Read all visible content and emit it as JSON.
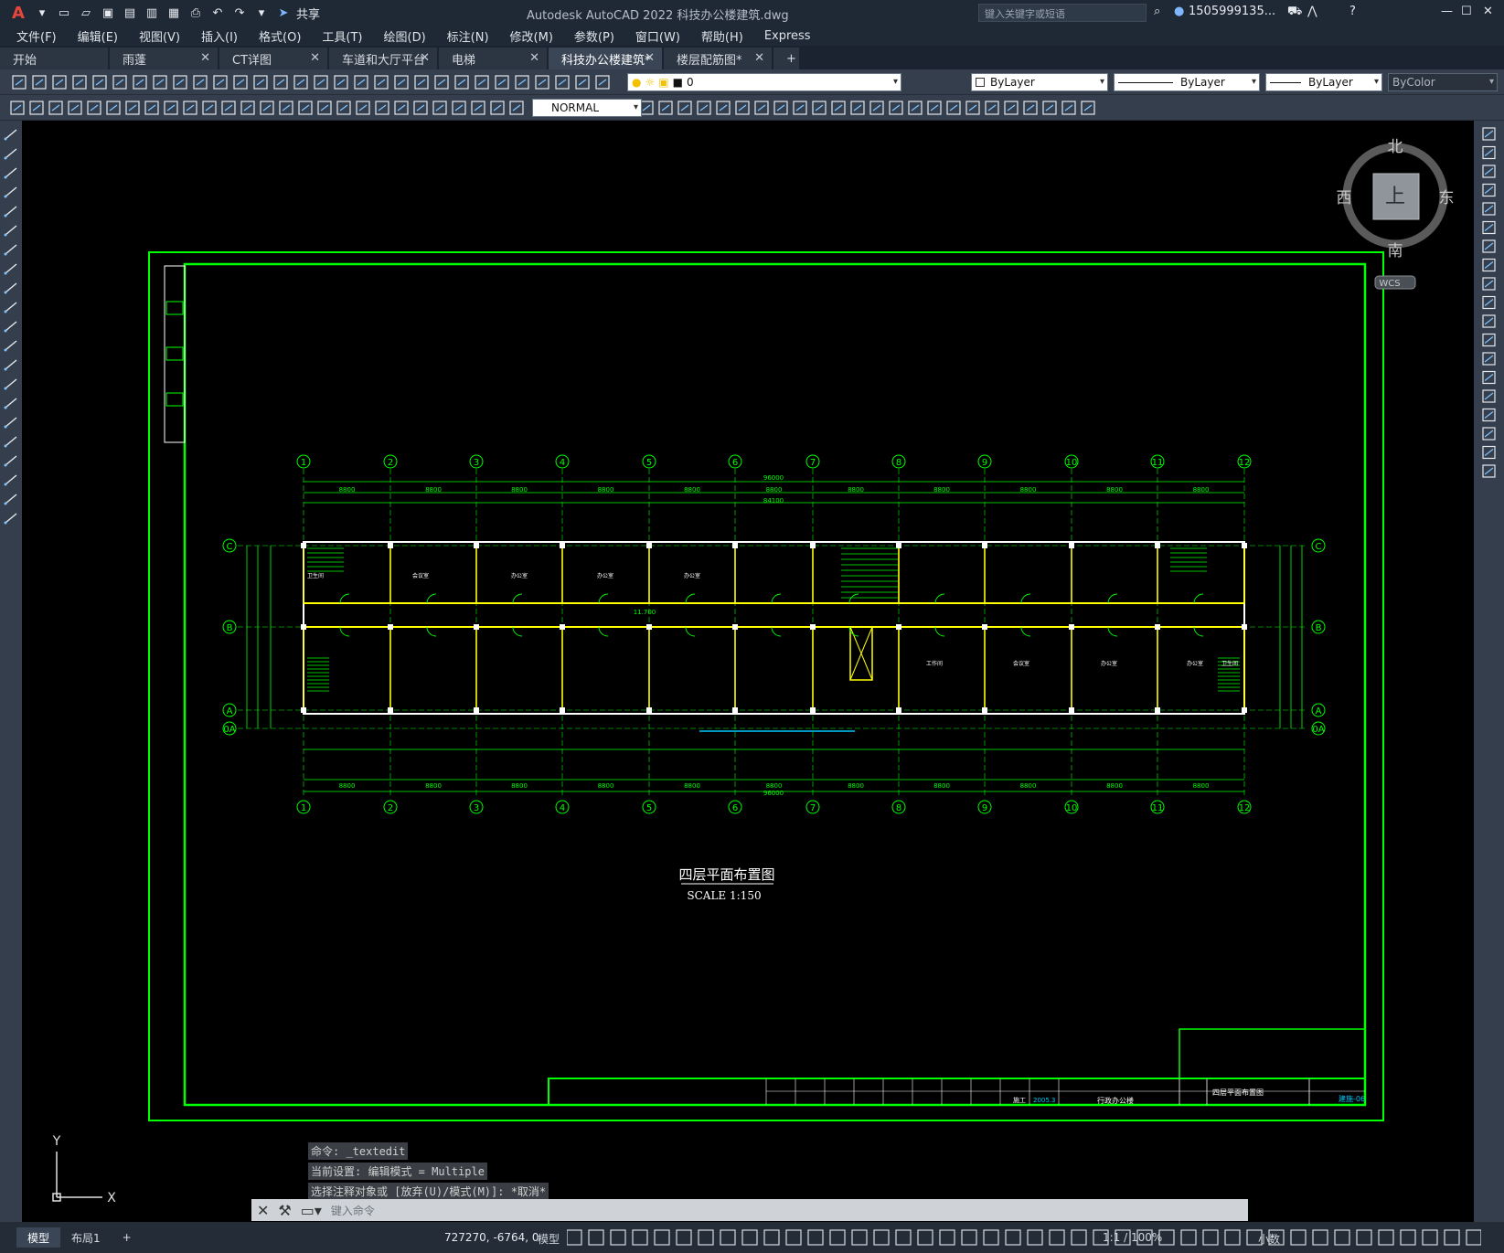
{
  "app": {
    "title": "Autodesk AutoCAD 2022    科技办公楼建筑.dwg",
    "share_label": "共享",
    "search_placeholder": "键入关键字或短语",
    "user": "1505999135...",
    "brand_color": "#e8463a"
  },
  "menu": [
    "文件(F)",
    "编辑(E)",
    "视图(V)",
    "插入(I)",
    "格式(O)",
    "工具(T)",
    "绘图(D)",
    "标注(N)",
    "修改(M)",
    "参数(P)",
    "窗口(W)",
    "帮助(H)",
    "Express"
  ],
  "tabs": [
    {
      "label": "开始",
      "closable": false
    },
    {
      "label": "雨蓬",
      "closable": true
    },
    {
      "label": "CT详图",
      "closable": true
    },
    {
      "label": "车道和大厅平台",
      "closable": true
    },
    {
      "label": "电梯",
      "closable": true
    },
    {
      "label": "科技办公楼建筑*",
      "closable": true,
      "active": true
    },
    {
      "label": "楼层配筋图*",
      "closable": true
    }
  ],
  "properties": {
    "layer": "0",
    "color": "ByLayer",
    "linetype": "ByLayer",
    "lineweight": "ByLayer",
    "plotstyle": "ByColor",
    "dimstyle": "NORMAL"
  },
  "viewcube": {
    "north": "北",
    "south": "南",
    "east": "东",
    "west": "西",
    "face": "上",
    "wcs": "WCS"
  },
  "drawing": {
    "title": "四层平面布置图",
    "scale": "SCALE 1:150",
    "axis_cols": [
      "1",
      "2",
      "3",
      "4",
      "5",
      "6",
      "7",
      "8",
      "9",
      "10",
      "11",
      "12"
    ],
    "axis_rows": [
      "C",
      "B",
      "A",
      "0A"
    ],
    "top_dims": [
      "8800",
      "8800",
      "8800",
      "8800",
      "8800",
      "8800",
      "8800",
      "8800",
      "8800",
      "8800",
      "8800"
    ],
    "total_dim": "96000",
    "inner_total": "84100",
    "bottom_dims": [
      "8800",
      "8800",
      "8800",
      "8800",
      "8800",
      "8800",
      "8800",
      "8800",
      "8800",
      "8800",
      "8800"
    ],
    "room_small_labels": [
      "卫生间",
      "会议室",
      "办公室",
      "办公室",
      "办公室",
      "工作间",
      "会议室",
      "办公室",
      "办公室",
      "卫生间"
    ],
    "elevation": "11.700",
    "titleblock": {
      "stage": "施工",
      "date": "2005.3",
      "project": "行政办公楼",
      "sheet_name": "四层平面布置图",
      "sheet_no": "建施-06"
    }
  },
  "command": {
    "history": [
      "命令: _textedit",
      "当前设置: 编辑模式 = Multiple",
      "选择注释对象或 [放弃(U)/模式(M)]: *取消*"
    ],
    "placeholder": "键入命令"
  },
  "status": {
    "tabs": [
      "模型",
      "布局1"
    ],
    "coords": "727270, -6764, 0",
    "space": "模型",
    "scale": "1:1 / 100%",
    "units": "小数"
  },
  "colors": {
    "drawing_green": "#00ff00",
    "wall_yellow": "#ffff00",
    "canvas": "#000000"
  }
}
